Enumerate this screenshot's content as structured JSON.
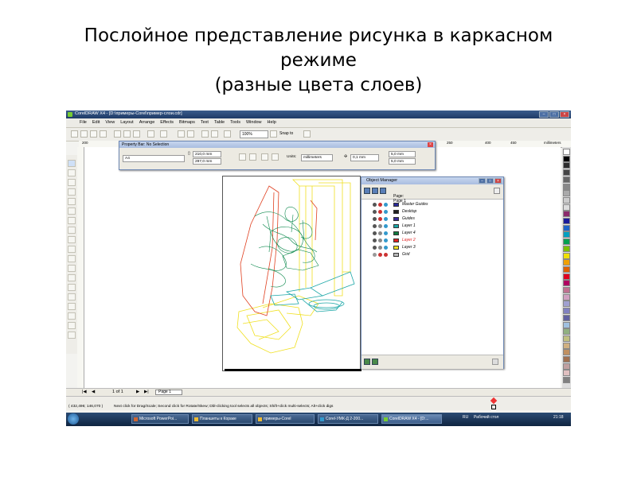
{
  "slide": {
    "title_line1": "Послойное представление рисунка в каркасном",
    "title_line2": "режиме",
    "title_line3": "(разные цвета слоев)"
  },
  "app": {
    "window_title": "CorelDRAW X4 - [D:\\примеры-Corel\\пример-слои.cdr]",
    "menu": [
      "File",
      "Edit",
      "View",
      "Layout",
      "Arrange",
      "Effects",
      "Bitmaps",
      "Text",
      "Table",
      "Tools",
      "Window",
      "Help"
    ],
    "zoom_value": "100%",
    "snap_label": "Snap to",
    "ruler_labels": [
      "200",
      "250",
      "400",
      "450",
      "millimeters"
    ]
  },
  "property_bar": {
    "title": "Property Bar: No Selection",
    "paper_size": "A4",
    "width": "210,0 mm",
    "height": "297,0 mm",
    "units_label": "Units:",
    "units_value": "millimeters",
    "nudge": "0,1 mm",
    "dup_x": "5,0 mm",
    "dup_y": "5,0 mm"
  },
  "object_manager": {
    "title": "Object Manager",
    "page_label": "Page:",
    "page_value": "Page 1",
    "layers": [
      {
        "name": "Master Guides",
        "color": "#2a2a9a",
        "active": false
      },
      {
        "name": "Desktop",
        "color": "#222222",
        "active": false
      },
      {
        "name": "Guides",
        "color": "#3a2a9a",
        "active": false
      },
      {
        "name": "Layer 1",
        "color": "#19a6a6",
        "active": false
      },
      {
        "name": "Layer 4",
        "color": "#0e7a3e",
        "active": false
      },
      {
        "name": "Layer 2",
        "color": "#e02020",
        "active": true
      },
      {
        "name": "Layer 3",
        "color": "#f0e020",
        "active": false
      },
      {
        "name": "Grid",
        "color": "#bbbbbb",
        "active": false
      }
    ]
  },
  "navigator": {
    "page_count": "1 of 1",
    "page_tab": "Page 1"
  },
  "status": {
    "coordinates": "( 432,496; 146,070 )",
    "hint": "Next click for Drag/Scale; Second click for Rotate/Skew; Dbl-clicking tool selects all objects; Shift+click multi-selects; Alt+click digs"
  },
  "taskbar": {
    "items": [
      "Microsoft PowerPoi...",
      "Планшеты к Кораке",
      "примеры-Corel",
      "Corel-УМК-Д 2-200...",
      "CorelDRAW X4 - [D:..."
    ],
    "lang": "RU",
    "desktop": "Рабочий стол",
    "clock": "21:18"
  },
  "palette_colors": [
    "#ffffff",
    "#000000",
    "#2b2b2b",
    "#444",
    "#666",
    "#888",
    "#aaa",
    "#ccc",
    "#ddd",
    "#8b2a6b",
    "#1a1a9a",
    "#1e64c8",
    "#00a0c0",
    "#00a050",
    "#7cc000",
    "#f0e000",
    "#f0a000",
    "#e06000",
    "#e00020",
    "#b00060",
    "#c07090",
    "#d0a0c0",
    "#a0a0d0",
    "#8080c0",
    "#6060a0",
    "#a0c0e0",
    "#90b080",
    "#c0c080",
    "#d0b080",
    "#c09060",
    "#a07050",
    "#c0a0a0",
    "#e0c0c0",
    "#808080"
  ]
}
